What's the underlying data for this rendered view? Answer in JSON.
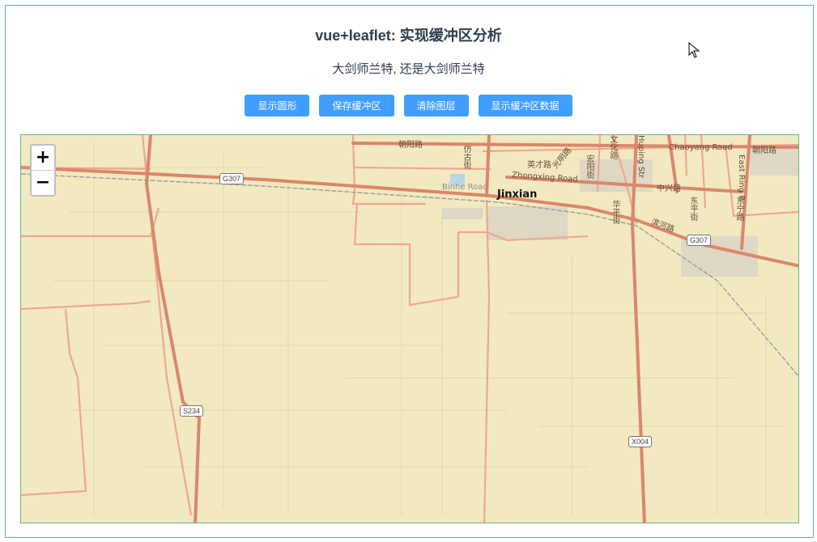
{
  "header": {
    "title": "vue+leaflet: 实现缓冲区分析",
    "subtitle": "大剑师兰特, 还是大剑师兰特"
  },
  "toolbar": {
    "buttons": [
      {
        "label": "显示圆形"
      },
      {
        "label": "保存缓冲区"
      },
      {
        "label": "清除图层"
      },
      {
        "label": "显示缓冲区数据"
      }
    ]
  },
  "map": {
    "zoom_in": "+",
    "zoom_out": "−",
    "city_label": "Jinxian",
    "shields": [
      "G307",
      "G307",
      "S234",
      "X004"
    ],
    "street_labels": {
      "chaoyang_west": "朝阳路",
      "chaoyang_east_en": "Chaoyang Road",
      "chaoyang_east_cn": "朝阳路",
      "zhongxing_en": "Zhongxing Road",
      "binhe_en": "Binhe Road",
      "yingcai": "英才路",
      "guangming": "光明路",
      "zhongxing_cn": "中兴路",
      "binhe_cn": "滨河路",
      "eastring_en": "East Ring R",
      "fanggu": "仿古街",
      "hongfu": "宏阳街",
      "huaping": "华平街",
      "huaping_en": "Huping Str",
      "dongping": "东平街",
      "dongning": "东宁路",
      "wenhua": "文化路"
    },
    "colors": {
      "land": "#f2e9c1",
      "major_road": "#d9876a",
      "minor_road": "#f0a68d",
      "rail": "#9a9a9a",
      "urban": "#d8d3c4",
      "border": "#5fb88a",
      "button": "#409eff"
    }
  }
}
